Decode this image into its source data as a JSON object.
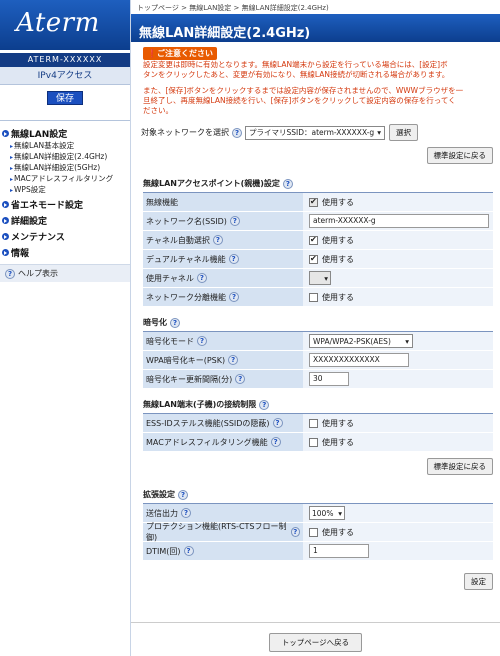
{
  "brand": {
    "logo": "Aterm",
    "model": "ATERM-XXXXXX",
    "mode": "IPv4アクセス",
    "save_label": "保存"
  },
  "nav": {
    "wireless": "無線LAN設定",
    "wireless_items": [
      "無線LAN基本設定",
      "無線LAN詳細設定(2.4GHz)",
      "無線LAN詳細設定(5GHz)",
      "MACアドレスフィルタリング",
      "WPS設定"
    ],
    "eco": "省エネモード設定",
    "detail": "詳細設定",
    "maint": "メンテナンス",
    "info": "情報",
    "help": "ヘルプ表示"
  },
  "breadcrumb": {
    "top": "トップページ",
    "sep": ">",
    "wireless": "無線LAN設定",
    "current": "無線LAN詳細設定(2.4GHz)"
  },
  "page_title": "無線LAN詳細設定(2.4GHz)",
  "notice": {
    "label": "ご注意ください",
    "line1": "設定変更は即時に有効となります。無線LAN端末から設定を行っている場合には、[設定]ボ",
    "line2": "タンをクリックしたあと、変更が有効になり、無線LAN接続が切断される場合があります。",
    "line3": "また、[保存]ボタンをクリックするまでは設定内容が保存されませんので、WWWブラウザを一",
    "line4": "旦終了し、再度無線LAN接続を行い、[保存]ボタンをクリックして設定内容の保存を行ってく",
    "line5": "ださい。"
  },
  "network_select": {
    "label": "対象ネットワークを選択",
    "value": "プライマリSSID：aterm-XXXXXX-g",
    "button": "選択"
  },
  "std_button": "標準設定に戻る",
  "ap_section": {
    "title": "無線LANアクセスポイント(親機)設定",
    "rows": [
      {
        "label": "無線機能",
        "value": "使用する"
      },
      {
        "label": "ネットワーク名(SSID)",
        "value": "aterm-XXXXXX-g"
      },
      {
        "label": "チャネル自動選択",
        "value": "使用する"
      },
      {
        "label": "デュアルチャネル機能",
        "value": "使用する"
      },
      {
        "label": "使用チャネル",
        "value": ""
      },
      {
        "label": "ネットワーク分離機能",
        "value": "使用する"
      }
    ]
  },
  "enc_section": {
    "title": "暗号化",
    "rows": [
      {
        "label": "暗号化モード",
        "value": "WPA/WPA2-PSK(AES)"
      },
      {
        "label": "WPA暗号化キー(PSK)",
        "value": "XXXXXXXXXXXXX"
      },
      {
        "label": "暗号化キー更新間隔(分)",
        "value": "30"
      }
    ]
  },
  "limit_section": {
    "title": "無線LAN端末(子機)の接続制限",
    "rows": [
      {
        "label": "ESS-IDステルス機能(SSIDの隠蔽)",
        "value": "使用する"
      },
      {
        "label": "MACアドレスフィルタリング機能",
        "value": "使用する"
      }
    ]
  },
  "ext_section": {
    "title": "拡張設定",
    "rows": [
      {
        "label": "送信出力",
        "value": "100%"
      },
      {
        "label": "プロテクション機能(RTS-CTSフロー制御)",
        "value": "使用する"
      },
      {
        "label": "DTIM(回)",
        "value": "1"
      }
    ]
  },
  "set_button": "設定",
  "back_button": "トップページへ戻る"
}
